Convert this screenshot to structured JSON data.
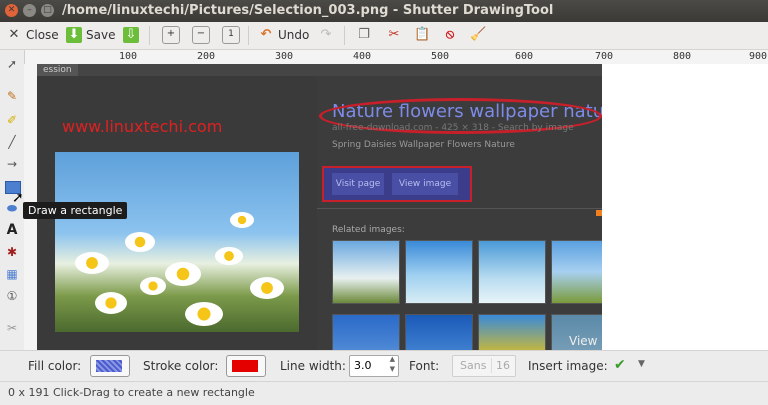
{
  "window": {
    "title": "/home/linuxtechi/Pictures/Selection_003.png - Shutter DrawingTool"
  },
  "toolbar": {
    "close_label": "Close",
    "save_label": "Save",
    "undo_label": "Undo"
  },
  "ruler": {
    "labels": [
      "100",
      "200",
      "300",
      "400",
      "500",
      "600",
      "700",
      "800",
      "900"
    ]
  },
  "canvas": {
    "tab_label": "ession",
    "watermark": "www.linuxtechi.com",
    "result_title": "Nature flowers wallpaper nature wa",
    "result_meta": "all-free-download.com - 425 × 318 - Search by image",
    "result_desc": "Spring Daisies Wallpaper Flowers Nature",
    "visit_page": "Visit page",
    "view_image": "View image",
    "related_images": "Related images:",
    "view_overlay": "View"
  },
  "tooltip": {
    "text": "Draw a rectangle"
  },
  "bottom": {
    "fill_color_label": "Fill color:",
    "stroke_color_label": "Stroke color:",
    "stroke_color": "#e50000",
    "fill_color": "#4b5bd0",
    "line_width_label": "Line width:",
    "line_width_value": "3.0",
    "font_label": "Font:",
    "font_name": "Sans",
    "font_size": "16",
    "insert_image_label": "Insert image:"
  },
  "status": {
    "text": "0 x 191 Click-Drag to create a new rectangle"
  }
}
